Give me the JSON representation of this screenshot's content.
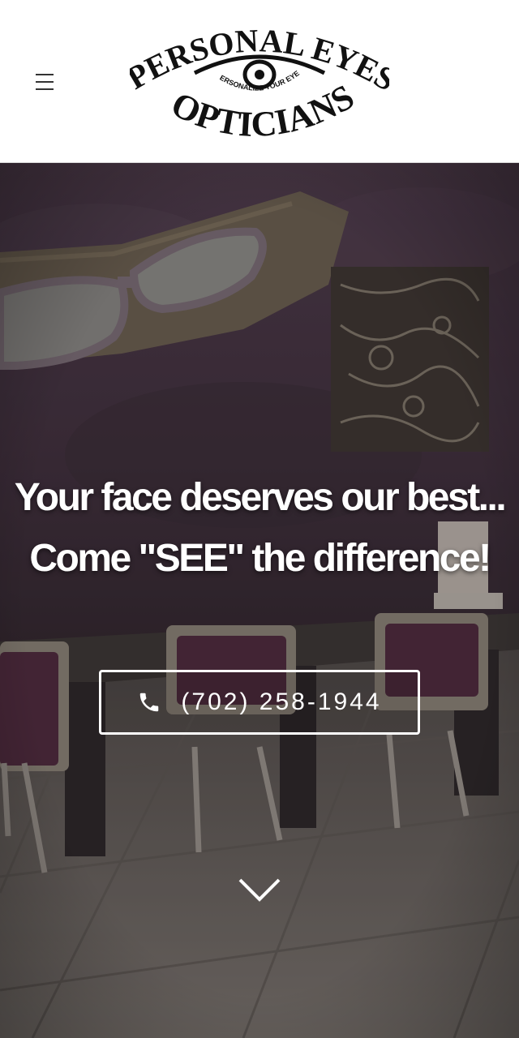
{
  "header": {
    "menu_icon": "hamburger-menu-icon",
    "logo": {
      "line1": "PERSONAL EYES",
      "line2": "OPTICIANS",
      "tagline": "PERSONALIZE YOUR EYES"
    }
  },
  "hero": {
    "headline_line1": "Your face deserves our best...",
    "headline_line2": "Come \"SEE\" the difference!",
    "phone_button": {
      "icon": "phone-icon",
      "number": "(702) 258-1944"
    },
    "scroll_icon": "chevron-down-icon"
  },
  "colors": {
    "header_bg": "#ffffff",
    "text_on_hero": "#ffffff",
    "wall": "#4a3a48",
    "floor": "#6a6560",
    "chair": "#4e2a3d"
  }
}
